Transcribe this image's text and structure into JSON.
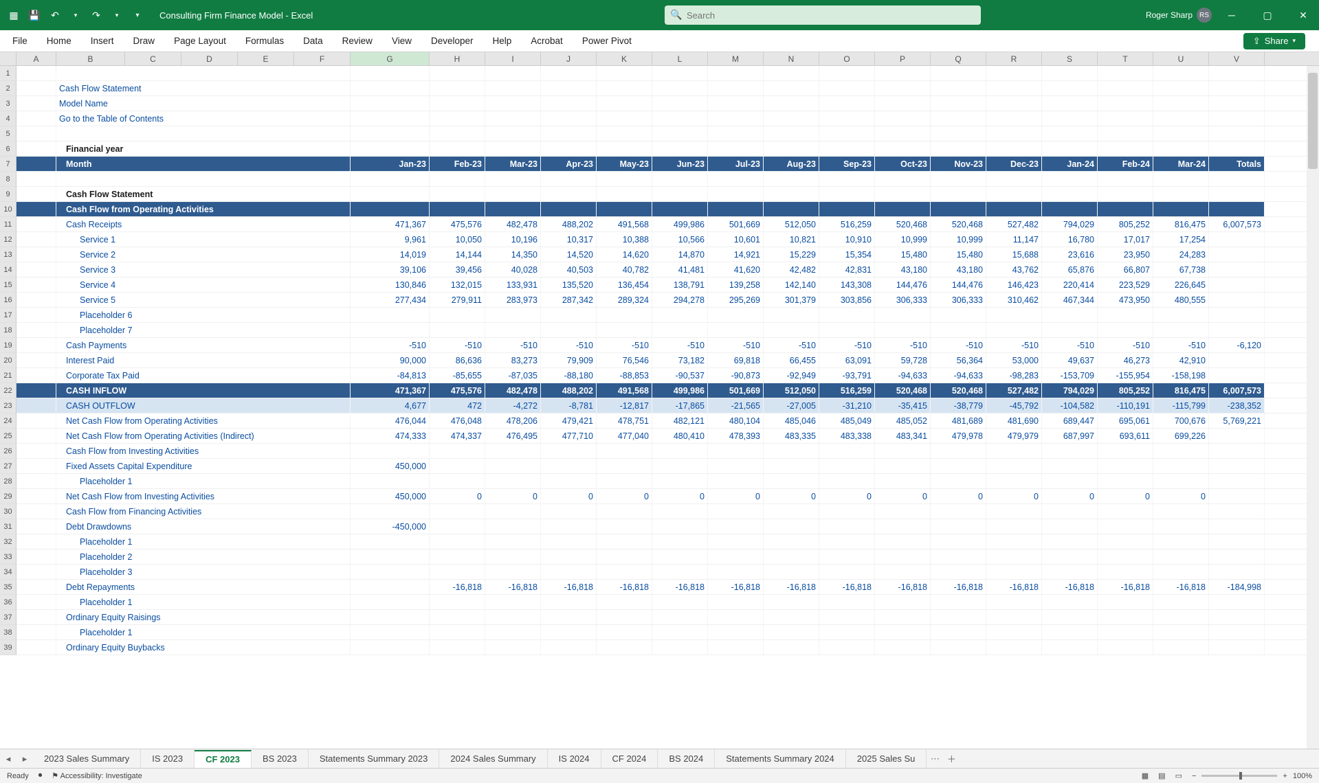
{
  "app": {
    "filename": "Consulting Firm Finance Model  -  Excel"
  },
  "user": {
    "name": "Roger Sharp",
    "initials": "RS"
  },
  "search": {
    "placeholder": "Search"
  },
  "ribbon_tabs": [
    "File",
    "Home",
    "Insert",
    "Draw",
    "Page Layout",
    "Formulas",
    "Data",
    "Review",
    "View",
    "Developer",
    "Help",
    "Acrobat",
    "Power Pivot"
  ],
  "share_label": "Share",
  "col_widths": {
    "A": 58,
    "B": 100,
    "C": 82,
    "D": 82,
    "E": 82,
    "F": 82,
    "wide": 115,
    "num": 81
  },
  "columns": [
    "A",
    "B",
    "C",
    "D",
    "E",
    "F",
    "G",
    "H",
    "I",
    "J",
    "K",
    "L",
    "M",
    "N",
    "O",
    "P",
    "Q",
    "R",
    "S",
    "T",
    "U",
    "V"
  ],
  "selected_col": "G",
  "months": [
    "Jan-23",
    "Feb-23",
    "Mar-23",
    "Apr-23",
    "May-23",
    "Jun-23",
    "Jul-23",
    "Aug-23",
    "Sep-23",
    "Oct-23",
    "Nov-23",
    "Dec-23",
    "Jan-24",
    "Feb-24",
    "Mar-24",
    "Totals"
  ],
  "titles": {
    "t1": "Cash Flow Statement",
    "t2": "Model Name",
    "t3": "Go to the Table of Contents",
    "fy": "Financial year",
    "month": "Month",
    "cfs": "Cash Flow Statement"
  },
  "rows": [
    {
      "n": 1,
      "type": "blank"
    },
    {
      "n": 2,
      "type": "title",
      "label": "Cash Flow Statement"
    },
    {
      "n": 3,
      "type": "sub",
      "label": "Model Name"
    },
    {
      "n": 4,
      "type": "link",
      "label": "Go to the Table of Contents"
    },
    {
      "n": 5,
      "type": "blank"
    },
    {
      "n": 6,
      "type": "bold",
      "label": "Financial year",
      "ind": 1
    },
    {
      "n": 7,
      "type": "hdr",
      "label": "Month",
      "months": true,
      "ind": 1
    },
    {
      "n": 8,
      "type": "blank"
    },
    {
      "n": 9,
      "type": "bold",
      "label": "Cash Flow Statement",
      "ind": 1
    },
    {
      "n": 10,
      "type": "sect",
      "label": "Cash Flow from Operating Activities",
      "ind": 1
    },
    {
      "n": 11,
      "label": "Cash Receipts",
      "ind": 1,
      "v": [
        "471,367",
        "475,576",
        "482,478",
        "488,202",
        "491,568",
        "499,986",
        "501,669",
        "512,050",
        "516,259",
        "520,468",
        "520,468",
        "527,482",
        "794,029",
        "805,252",
        "816,475",
        "6,007,573"
      ]
    },
    {
      "n": 12,
      "label": "Service 1",
      "ind": 2,
      "v": [
        "9,961",
        "10,050",
        "10,196",
        "10,317",
        "10,388",
        "10,566",
        "10,601",
        "10,821",
        "10,910",
        "10,999",
        "10,999",
        "11,147",
        "16,780",
        "17,017",
        "17,254",
        ""
      ]
    },
    {
      "n": 13,
      "label": "Service 2",
      "ind": 2,
      "v": [
        "14,019",
        "14,144",
        "14,350",
        "14,520",
        "14,620",
        "14,870",
        "14,921",
        "15,229",
        "15,354",
        "15,480",
        "15,480",
        "15,688",
        "23,616",
        "23,950",
        "24,283",
        ""
      ]
    },
    {
      "n": 14,
      "label": "Service 3",
      "ind": 2,
      "v": [
        "39,106",
        "39,456",
        "40,028",
        "40,503",
        "40,782",
        "41,481",
        "41,620",
        "42,482",
        "42,831",
        "43,180",
        "43,180",
        "43,762",
        "65,876",
        "66,807",
        "67,738",
        ""
      ]
    },
    {
      "n": 15,
      "label": "Service 4",
      "ind": 2,
      "v": [
        "130,846",
        "132,015",
        "133,931",
        "135,520",
        "136,454",
        "138,791",
        "139,258",
        "142,140",
        "143,308",
        "144,476",
        "144,476",
        "146,423",
        "220,414",
        "223,529",
        "226,645",
        ""
      ]
    },
    {
      "n": 16,
      "label": "Service 5",
      "ind": 2,
      "v": [
        "277,434",
        "279,911",
        "283,973",
        "287,342",
        "289,324",
        "294,278",
        "295,269",
        "301,379",
        "303,856",
        "306,333",
        "306,333",
        "310,462",
        "467,344",
        "473,950",
        "480,555",
        ""
      ]
    },
    {
      "n": 17,
      "label": "Placeholder 6",
      "ind": 2
    },
    {
      "n": 18,
      "label": "Placeholder 7",
      "ind": 2
    },
    {
      "n": 19,
      "label": "Cash Payments",
      "ind": 1,
      "v": [
        "-510",
        "-510",
        "-510",
        "-510",
        "-510",
        "-510",
        "-510",
        "-510",
        "-510",
        "-510",
        "-510",
        "-510",
        "-510",
        "-510",
        "-510",
        "-6,120"
      ]
    },
    {
      "n": 20,
      "label": "Interest Paid",
      "ind": 1,
      "v": [
        "90,000",
        "86,636",
        "83,273",
        "79,909",
        "76,546",
        "73,182",
        "69,818",
        "66,455",
        "63,091",
        "59,728",
        "56,364",
        "53,000",
        "49,637",
        "46,273",
        "42,910",
        ""
      ]
    },
    {
      "n": 21,
      "label": "Corporate Tax Paid",
      "ind": 1,
      "v": [
        "-84,813",
        "-85,655",
        "-87,035",
        "-88,180",
        "-88,853",
        "-90,537",
        "-90,873",
        "-92,949",
        "-93,791",
        "-94,633",
        "-94,633",
        "-98,283",
        "-153,709",
        "-155,954",
        "-158,198",
        ""
      ]
    },
    {
      "n": 22,
      "type": "hl",
      "label": "CASH INFLOW",
      "ind": 1,
      "v": [
        "471,367",
        "475,576",
        "482,478",
        "488,202",
        "491,568",
        "499,986",
        "501,669",
        "512,050",
        "516,259",
        "520,468",
        "520,468",
        "527,482",
        "794,029",
        "805,252",
        "816,475",
        "6,007,573"
      ]
    },
    {
      "n": 23,
      "type": "hl2",
      "label": "CASH OUTFLOW",
      "ind": 1,
      "v": [
        "4,677",
        "472",
        "-4,272",
        "-8,781",
        "-12,817",
        "-17,865",
        "-21,565",
        "-27,005",
        "-31,210",
        "-35,415",
        "-38,779",
        "-45,792",
        "-104,582",
        "-110,191",
        "-115,799",
        "-238,352"
      ]
    },
    {
      "n": 24,
      "label": "Net Cash Flow from Operating Activities",
      "ind": 1,
      "v": [
        "476,044",
        "476,048",
        "478,206",
        "479,421",
        "478,751",
        "482,121",
        "480,104",
        "485,046",
        "485,049",
        "485,052",
        "481,689",
        "481,690",
        "689,447",
        "695,061",
        "700,676",
        "5,769,221"
      ]
    },
    {
      "n": 25,
      "label": "Net Cash Flow from Operating Activities (Indirect)",
      "ind": 1,
      "v": [
        "474,333",
        "474,337",
        "476,495",
        "477,710",
        "477,040",
        "480,410",
        "478,393",
        "483,335",
        "483,338",
        "483,341",
        "479,978",
        "479,979",
        "687,997",
        "693,611",
        "699,226",
        ""
      ]
    },
    {
      "n": 26,
      "type": "boldblue",
      "label": "Cash Flow from Investing Activities",
      "ind": 1
    },
    {
      "n": 27,
      "label": "Fixed Assets Capital Expenditure",
      "ind": 1,
      "v": [
        "450,000",
        "",
        "",
        "",
        "",
        "",
        "",
        "",
        "",
        "",
        "",
        "",
        "",
        "",
        "",
        ""
      ]
    },
    {
      "n": 28,
      "label": "Placeholder 1",
      "ind": 2
    },
    {
      "n": 29,
      "label": "Net Cash Flow from Investing Activities",
      "ind": 1,
      "v": [
        "450,000",
        "0",
        "0",
        "0",
        "0",
        "0",
        "0",
        "0",
        "0",
        "0",
        "0",
        "0",
        "0",
        "0",
        "0",
        ""
      ]
    },
    {
      "n": 30,
      "type": "boldblue",
      "label": "Cash Flow from Financing Activities",
      "ind": 1
    },
    {
      "n": 31,
      "label": "Debt Drawdowns",
      "ind": 1,
      "v": [
        "-450,000",
        "",
        "",
        "",
        "",
        "",
        "",
        "",
        "",
        "",
        "",
        "",
        "",
        "",
        "",
        ""
      ]
    },
    {
      "n": 32,
      "label": "Placeholder 1",
      "ind": 2
    },
    {
      "n": 33,
      "label": "Placeholder 2",
      "ind": 2
    },
    {
      "n": 34,
      "label": "Placeholder 3",
      "ind": 2
    },
    {
      "n": 35,
      "label": "Debt Repayments",
      "ind": 1,
      "v": [
        "",
        "-16,818",
        "-16,818",
        "-16,818",
        "-16,818",
        "-16,818",
        "-16,818",
        "-16,818",
        "-16,818",
        "-16,818",
        "-16,818",
        "-16,818",
        "-16,818",
        "-16,818",
        "-16,818",
        "-184,998"
      ]
    },
    {
      "n": 36,
      "label": "Placeholder 1",
      "ind": 2
    },
    {
      "n": 37,
      "label": "Ordinary Equity Raisings",
      "ind": 1
    },
    {
      "n": 38,
      "label": "Placeholder 1",
      "ind": 2
    },
    {
      "n": 39,
      "label": "Ordinary Equity Buybacks",
      "ind": 1
    }
  ],
  "sheet_tabs": [
    "2023 Sales Summary",
    "IS 2023",
    "CF 2023",
    "BS 2023",
    "Statements Summary 2023",
    "2024 Sales Summary",
    "IS 2024",
    "CF 2024",
    "BS 2024",
    "Statements Summary 2024",
    "2025 Sales Su"
  ],
  "active_tab": "CF 2023",
  "status": {
    "ready": "Ready",
    "acc": "Accessibility: Investigate",
    "zoom": "100%"
  }
}
